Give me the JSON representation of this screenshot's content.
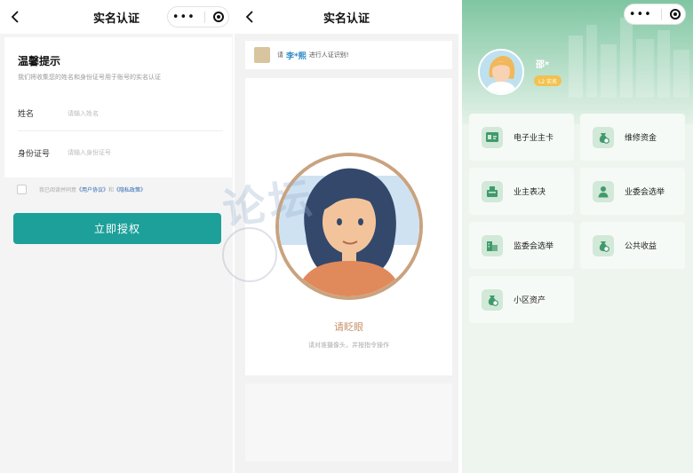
{
  "panel1": {
    "nav_title": "实名认证",
    "tip_title": "温馨提示",
    "tip_desc": "我们将收集您的姓名和身份证号用于账号的实名认证",
    "fields": [
      {
        "label": "姓名",
        "placeholder": "请输入姓名"
      },
      {
        "label": "身份证号",
        "placeholder": "请输入身份证号"
      }
    ],
    "agree_prefix": "我已阅读并同意",
    "agree_link1": "《用户协议》",
    "agree_and": "和",
    "agree_link2": "《隐私政策》",
    "button": "立即授权",
    "accent": "#1ea09a"
  },
  "panel2": {
    "nav_title": "实名认证",
    "banner_prefix": "请",
    "banner_name": "李*熙",
    "banner_suffix": "进行人证识别!",
    "prompt": "请眨眼",
    "instruction": "请对准摄像头，并按指令操作"
  },
  "panel3": {
    "user_name": "邵*",
    "badge": "L2 实名",
    "tiles": [
      {
        "label": "电子业主卡",
        "icon": "id-card-icon"
      },
      {
        "label": "维修资金",
        "icon": "money-bag-icon"
      },
      {
        "label": "业主表决",
        "icon": "ballot-box-icon"
      },
      {
        "label": "业委会选举",
        "icon": "person-icon"
      },
      {
        "label": "监委会选举",
        "icon": "building-icon"
      },
      {
        "label": "公共收益",
        "icon": "money-bag-icon"
      },
      {
        "label": "小区资产",
        "icon": "money-bag-icon"
      }
    ]
  },
  "watermark": "论坛"
}
